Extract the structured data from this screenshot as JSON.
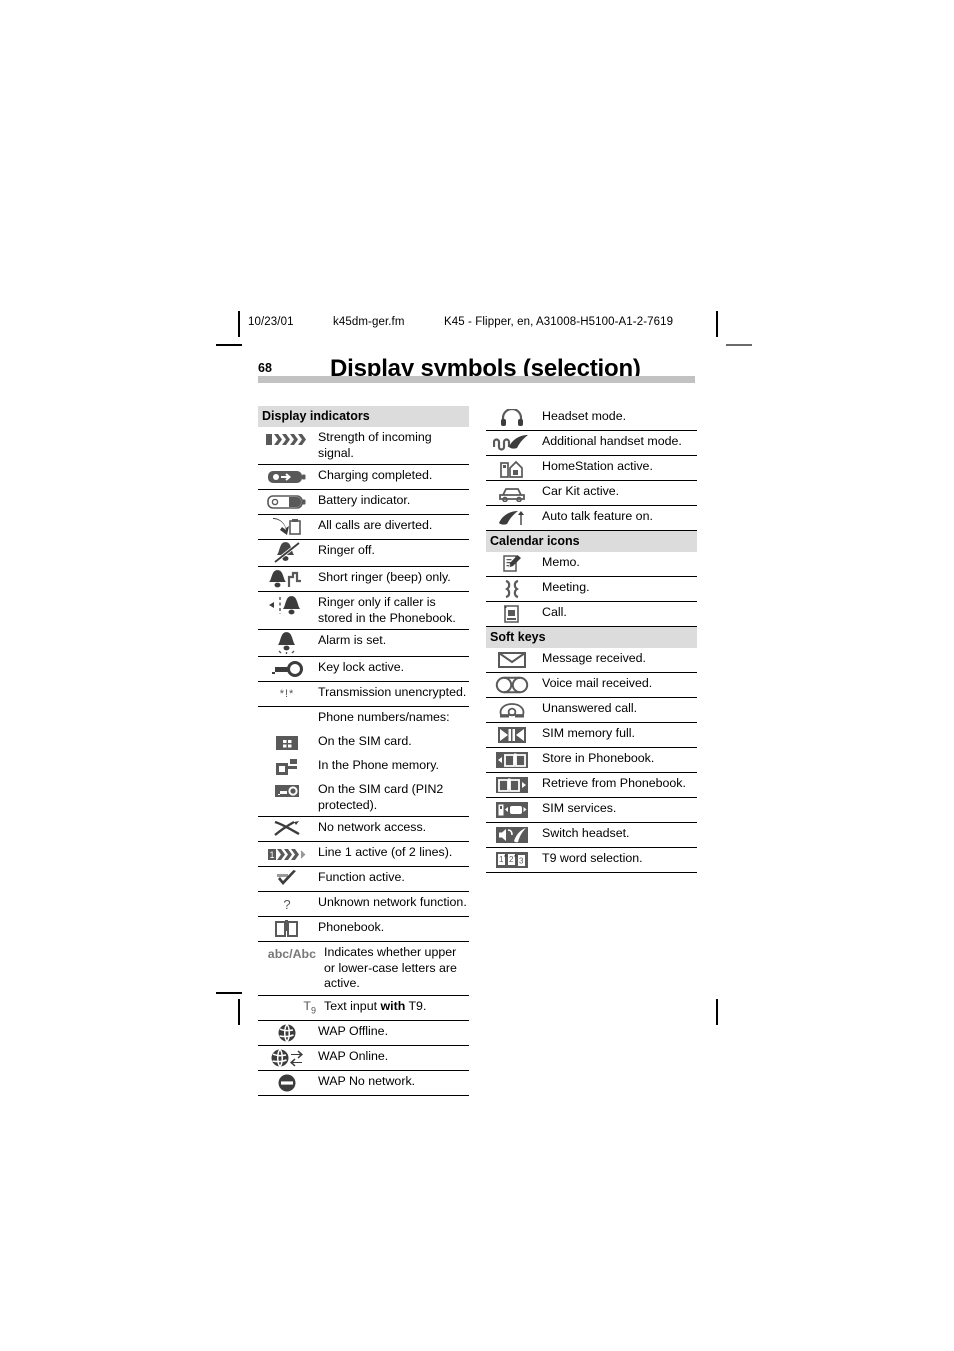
{
  "running_header": {
    "date": "10/23/01",
    "filename": "k45dm-ger.fm",
    "docref": "K45 - Flipper, en, A31008-H5100-A1-2-7619"
  },
  "page_number": "68",
  "title": "Display symbols (selection)",
  "colors": {
    "section_band": "#dcdcdc",
    "title_rule": "#c2c2c2",
    "icon_gray": "#595959",
    "rule": "#000000"
  },
  "left_column": {
    "sections": [
      {
        "heading": "Display indicators",
        "rows": [
          {
            "icon": "signal-strength-icon",
            "text": "Strength of incoming signal."
          },
          {
            "icon": "battery-charging-complete-icon",
            "text": "Charging completed."
          },
          {
            "icon": "battery-indicator-icon",
            "text": "Battery indicator."
          },
          {
            "icon": "call-divert-icon",
            "text": "All calls are diverted."
          },
          {
            "icon": "ringer-off-icon",
            "text": "Ringer off."
          },
          {
            "icon": "short-ringer-beep-icon",
            "text": "Short ringer (beep) only."
          },
          {
            "icon": "ringer-phonebook-only-icon",
            "text": "Ringer only if caller is stored in the Phonebook."
          },
          {
            "icon": "alarm-bell-icon",
            "text": "Alarm is set."
          },
          {
            "icon": "key-lock-icon",
            "text": "Key lock active."
          },
          {
            "icon": "transmission-unencrypted-icon",
            "text": "Transmission unencrypted."
          },
          {
            "icon": "none",
            "text": "Phone numbers/names:",
            "group_start": true
          },
          {
            "icon": "sim-card-icon",
            "text": "On the SIM card.",
            "group_mid": true
          },
          {
            "icon": "phone-memory-icon",
            "text": "In the Phone memory.",
            "group_mid": true
          },
          {
            "icon": "sim-pin2-icon",
            "text": "On the SIM card (PIN2 protected)."
          },
          {
            "icon": "no-network-icon",
            "text": "No network access."
          },
          {
            "icon": "line-1-active-icon",
            "text": "Line 1 active (of 2 lines)."
          },
          {
            "icon": "function-active-check-icon",
            "text": "Function active."
          },
          {
            "icon": "unknown-network-function-icon",
            "text": "Unknown network function."
          },
          {
            "icon": "phonebook-icon",
            "text": "Phonebook."
          },
          {
            "icon": "abc-case-icon",
            "text": "Indicates whether upper or lower-case letters are active."
          },
          {
            "icon": "t9-icon",
            "text_before": "Text input ",
            "text_bold": "with",
            "text_after": " T9."
          },
          {
            "icon": "wap-offline-icon",
            "text": "WAP Offline."
          },
          {
            "icon": "wap-online-icon",
            "text": "WAP Online."
          },
          {
            "icon": "wap-no-network-icon",
            "text": "WAP No network."
          }
        ]
      }
    ]
  },
  "right_column": {
    "sections": [
      {
        "heading": null,
        "rows": [
          {
            "icon": "headset-icon",
            "text": "Headset mode."
          },
          {
            "icon": "additional-handset-icon",
            "text": "Additional handset mode."
          },
          {
            "icon": "homestation-icon",
            "text": "HomeStation active."
          },
          {
            "icon": "car-kit-icon",
            "text": "Car Kit active."
          },
          {
            "icon": "auto-talk-icon",
            "text": "Auto talk feature on."
          }
        ]
      },
      {
        "heading": "Calendar icons",
        "rows": [
          {
            "icon": "memo-icon",
            "text": "Memo."
          },
          {
            "icon": "meeting-icon",
            "text": "Meeting."
          },
          {
            "icon": "call-icon",
            "text": "Call."
          }
        ]
      },
      {
        "heading": "Soft keys",
        "rows": [
          {
            "icon": "message-received-icon",
            "text": "Message received."
          },
          {
            "icon": "voice-mail-icon",
            "text": "Voice mail received."
          },
          {
            "icon": "unanswered-call-icon",
            "text": "Unanswered call."
          },
          {
            "icon": "sim-memory-full-icon",
            "text": "SIM memory full."
          },
          {
            "icon": "store-in-phonebook-icon",
            "text": "Store in Phonebook."
          },
          {
            "icon": "retrieve-from-phonebook-icon",
            "text": "Retrieve from Phonebook."
          },
          {
            "icon": "sim-services-icon",
            "text": "SIM services."
          },
          {
            "icon": "switch-headset-icon",
            "text": "Switch headset."
          },
          {
            "icon": "t9-word-selection-icon",
            "text": "T9 word selection."
          }
        ]
      }
    ]
  }
}
